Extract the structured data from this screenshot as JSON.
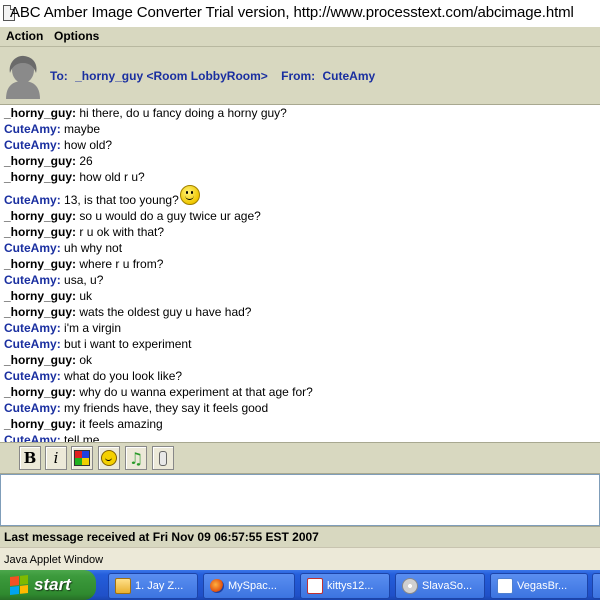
{
  "window": {
    "title": "ABC Amber Image Converter Trial version, http://www.processtext.com/abcimage.html"
  },
  "menu": {
    "items": [
      {
        "label": "Action"
      },
      {
        "label": "Options"
      }
    ]
  },
  "header": {
    "to_label": "To:",
    "to_value": "_horny_guy <Room LobbyRoom>",
    "from_label": "From:",
    "from_value": "CuteAmy"
  },
  "chat": {
    "messages": [
      {
        "sender": "_horny_guy",
        "text": "hi there, do u fancy doing a horny guy?"
      },
      {
        "sender": "CuteAmy",
        "text": "maybe"
      },
      {
        "sender": "CuteAmy",
        "text": "how old?"
      },
      {
        "sender": "_horny_guy",
        "text": "26"
      },
      {
        "sender": "_horny_guy",
        "text": "how old r u?"
      },
      {
        "sender": "CuteAmy",
        "text": "13, is that too young?"
      },
      {
        "sender": "_horny_guy",
        "text": "so u would do a guy twice ur age?"
      },
      {
        "sender": "_horny_guy",
        "text": "r u ok with that?"
      },
      {
        "sender": "CuteAmy",
        "text": "uh why not"
      },
      {
        "sender": "_horny_guy",
        "text": "where r u from?"
      },
      {
        "sender": "CuteAmy",
        "text": "usa, u?"
      },
      {
        "sender": "_horny_guy",
        "text": "uk"
      },
      {
        "sender": "_horny_guy",
        "text": "wats the oldest guy u have had?"
      },
      {
        "sender": "CuteAmy",
        "text": "i'm a virgin"
      },
      {
        "sender": "CuteAmy",
        "text": "but i want to experiment"
      },
      {
        "sender": "_horny_guy",
        "text": "ok"
      },
      {
        "sender": "CuteAmy",
        "text": "what do you look like?"
      },
      {
        "sender": "_horny_guy",
        "text": "why do u wanna experiment at that age for?"
      },
      {
        "sender": "CuteAmy",
        "text": "my friends have, they say it feels good"
      },
      {
        "sender": "_horny_guy",
        "text": "it feels amazing"
      },
      {
        "sender": "CuteAmy",
        "text": "tell me"
      }
    ]
  },
  "toolbar": {
    "bold_label": "B",
    "italic_label": "i",
    "buttons": [
      "bold-icon",
      "italic-icon",
      "color-palette-icon",
      "smiley-icon",
      "music-note-icon",
      "microphone-icon"
    ],
    "note_glyph": "♫"
  },
  "input": {
    "value": ""
  },
  "status": {
    "text": "Last message received at Fri Nov 09 06:57:55 EST 2007"
  },
  "applet": {
    "text": "Java Applet Window"
  },
  "taskbar": {
    "start_label": "start",
    "tasks": [
      {
        "label": "1. Jay Z...",
        "icon": "folder-icon"
      },
      {
        "label": "MySpac...",
        "icon": "firefox-icon"
      },
      {
        "label": "kittys12...",
        "icon": "chat-icon"
      },
      {
        "label": "SlavaSo...",
        "icon": "palette-icon"
      },
      {
        "label": "VegasBr...",
        "icon": "page-icon"
      }
    ]
  },
  "colors": {
    "panel": "#d8d8c0",
    "link_blue": "#1a2fa0",
    "taskbar_blue": "#245edb",
    "start_green": "#3c9a3c"
  }
}
